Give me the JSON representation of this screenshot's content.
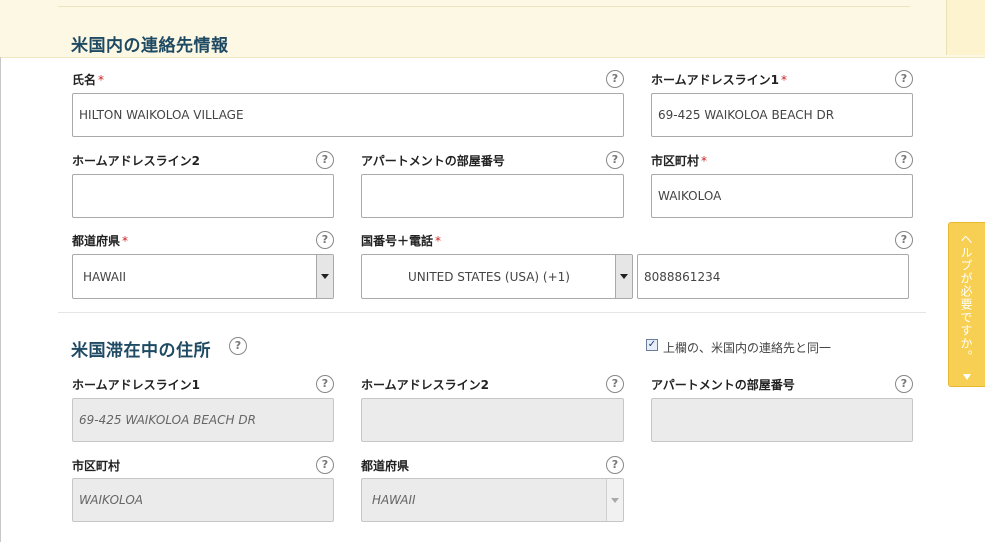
{
  "sections": {
    "contact_title": "米国内の連絡先情報",
    "address_title": "米国滞在中の住所"
  },
  "contact": {
    "name": {
      "label": "氏名",
      "required": "*",
      "value": "HILTON WAIKOLOA VILLAGE"
    },
    "home_address1": {
      "label": "ホームアドレスライン1",
      "required": "*",
      "value": "69-425 WAIKOLOA BEACH DR"
    },
    "home_address2": {
      "label": "ホームアドレスライン2",
      "value": ""
    },
    "apartment": {
      "label": "アパートメントの部屋番号",
      "value": ""
    },
    "city": {
      "label": "市区町村",
      "required": "*",
      "value": "WAIKOLOA"
    },
    "state": {
      "label": "都道府県",
      "required": "*",
      "value": "HAWAII"
    },
    "phone": {
      "label": "国番号＋電話",
      "required": "*",
      "country": "UNITED STATES (USA) (+1)",
      "number": "8088861234"
    }
  },
  "stay_address": {
    "same_as_above": {
      "checked": true,
      "mark": "✓",
      "label": "上欄の、米国内の連絡先と同一"
    },
    "home_address1": {
      "label": "ホームアドレスライン1",
      "value": "69-425 WAIKOLOA BEACH DR"
    },
    "home_address2": {
      "label": "ホームアドレスライン2",
      "value": ""
    },
    "apartment": {
      "label": "アパートメントの部屋番号",
      "value": ""
    },
    "city": {
      "label": "市区町村",
      "value": "WAIKOLOA"
    },
    "state": {
      "label": "都道府県",
      "value": "HAWAII"
    }
  },
  "help_icon_glyph": "?",
  "help_tab": {
    "label": "ヘルプが必要ですか。"
  },
  "colors": {
    "title": "#1f4a63",
    "required": "#cc2222",
    "help_tab": "#f7cf53",
    "top_band": "#fdf8e3"
  }
}
